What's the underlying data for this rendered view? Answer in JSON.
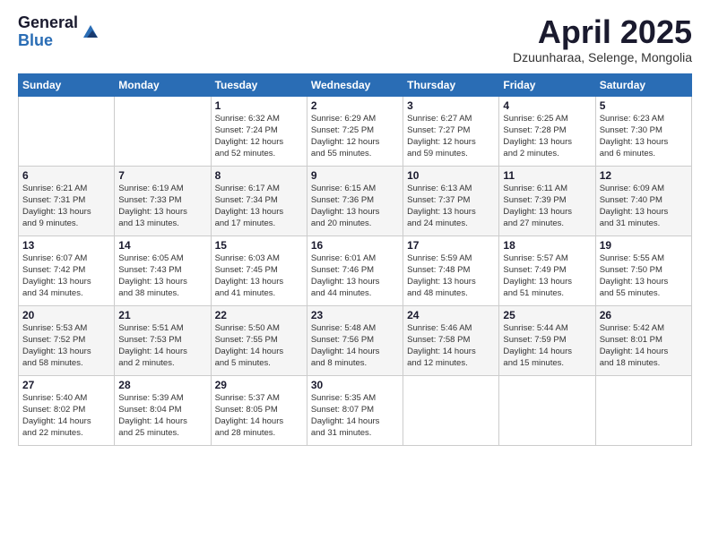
{
  "header": {
    "logo_general": "General",
    "logo_blue": "Blue",
    "month_title": "April 2025",
    "location": "Dzuunharaa, Selenge, Mongolia"
  },
  "calendar": {
    "days_of_week": [
      "Sunday",
      "Monday",
      "Tuesday",
      "Wednesday",
      "Thursday",
      "Friday",
      "Saturday"
    ],
    "weeks": [
      [
        {
          "day": "",
          "info": ""
        },
        {
          "day": "",
          "info": ""
        },
        {
          "day": "1",
          "info": "Sunrise: 6:32 AM\nSunset: 7:24 PM\nDaylight: 12 hours\nand 52 minutes."
        },
        {
          "day": "2",
          "info": "Sunrise: 6:29 AM\nSunset: 7:25 PM\nDaylight: 12 hours\nand 55 minutes."
        },
        {
          "day": "3",
          "info": "Sunrise: 6:27 AM\nSunset: 7:27 PM\nDaylight: 12 hours\nand 59 minutes."
        },
        {
          "day": "4",
          "info": "Sunrise: 6:25 AM\nSunset: 7:28 PM\nDaylight: 13 hours\nand 2 minutes."
        },
        {
          "day": "5",
          "info": "Sunrise: 6:23 AM\nSunset: 7:30 PM\nDaylight: 13 hours\nand 6 minutes."
        }
      ],
      [
        {
          "day": "6",
          "info": "Sunrise: 6:21 AM\nSunset: 7:31 PM\nDaylight: 13 hours\nand 9 minutes."
        },
        {
          "day": "7",
          "info": "Sunrise: 6:19 AM\nSunset: 7:33 PM\nDaylight: 13 hours\nand 13 minutes."
        },
        {
          "day": "8",
          "info": "Sunrise: 6:17 AM\nSunset: 7:34 PM\nDaylight: 13 hours\nand 17 minutes."
        },
        {
          "day": "9",
          "info": "Sunrise: 6:15 AM\nSunset: 7:36 PM\nDaylight: 13 hours\nand 20 minutes."
        },
        {
          "day": "10",
          "info": "Sunrise: 6:13 AM\nSunset: 7:37 PM\nDaylight: 13 hours\nand 24 minutes."
        },
        {
          "day": "11",
          "info": "Sunrise: 6:11 AM\nSunset: 7:39 PM\nDaylight: 13 hours\nand 27 minutes."
        },
        {
          "day": "12",
          "info": "Sunrise: 6:09 AM\nSunset: 7:40 PM\nDaylight: 13 hours\nand 31 minutes."
        }
      ],
      [
        {
          "day": "13",
          "info": "Sunrise: 6:07 AM\nSunset: 7:42 PM\nDaylight: 13 hours\nand 34 minutes."
        },
        {
          "day": "14",
          "info": "Sunrise: 6:05 AM\nSunset: 7:43 PM\nDaylight: 13 hours\nand 38 minutes."
        },
        {
          "day": "15",
          "info": "Sunrise: 6:03 AM\nSunset: 7:45 PM\nDaylight: 13 hours\nand 41 minutes."
        },
        {
          "day": "16",
          "info": "Sunrise: 6:01 AM\nSunset: 7:46 PM\nDaylight: 13 hours\nand 44 minutes."
        },
        {
          "day": "17",
          "info": "Sunrise: 5:59 AM\nSunset: 7:48 PM\nDaylight: 13 hours\nand 48 minutes."
        },
        {
          "day": "18",
          "info": "Sunrise: 5:57 AM\nSunset: 7:49 PM\nDaylight: 13 hours\nand 51 minutes."
        },
        {
          "day": "19",
          "info": "Sunrise: 5:55 AM\nSunset: 7:50 PM\nDaylight: 13 hours\nand 55 minutes."
        }
      ],
      [
        {
          "day": "20",
          "info": "Sunrise: 5:53 AM\nSunset: 7:52 PM\nDaylight: 13 hours\nand 58 minutes."
        },
        {
          "day": "21",
          "info": "Sunrise: 5:51 AM\nSunset: 7:53 PM\nDaylight: 14 hours\nand 2 minutes."
        },
        {
          "day": "22",
          "info": "Sunrise: 5:50 AM\nSunset: 7:55 PM\nDaylight: 14 hours\nand 5 minutes."
        },
        {
          "day": "23",
          "info": "Sunrise: 5:48 AM\nSunset: 7:56 PM\nDaylight: 14 hours\nand 8 minutes."
        },
        {
          "day": "24",
          "info": "Sunrise: 5:46 AM\nSunset: 7:58 PM\nDaylight: 14 hours\nand 12 minutes."
        },
        {
          "day": "25",
          "info": "Sunrise: 5:44 AM\nSunset: 7:59 PM\nDaylight: 14 hours\nand 15 minutes."
        },
        {
          "day": "26",
          "info": "Sunrise: 5:42 AM\nSunset: 8:01 PM\nDaylight: 14 hours\nand 18 minutes."
        }
      ],
      [
        {
          "day": "27",
          "info": "Sunrise: 5:40 AM\nSunset: 8:02 PM\nDaylight: 14 hours\nand 22 minutes."
        },
        {
          "day": "28",
          "info": "Sunrise: 5:39 AM\nSunset: 8:04 PM\nDaylight: 14 hours\nand 25 minutes."
        },
        {
          "day": "29",
          "info": "Sunrise: 5:37 AM\nSunset: 8:05 PM\nDaylight: 14 hours\nand 28 minutes."
        },
        {
          "day": "30",
          "info": "Sunrise: 5:35 AM\nSunset: 8:07 PM\nDaylight: 14 hours\nand 31 minutes."
        },
        {
          "day": "",
          "info": ""
        },
        {
          "day": "",
          "info": ""
        },
        {
          "day": "",
          "info": ""
        }
      ]
    ]
  }
}
